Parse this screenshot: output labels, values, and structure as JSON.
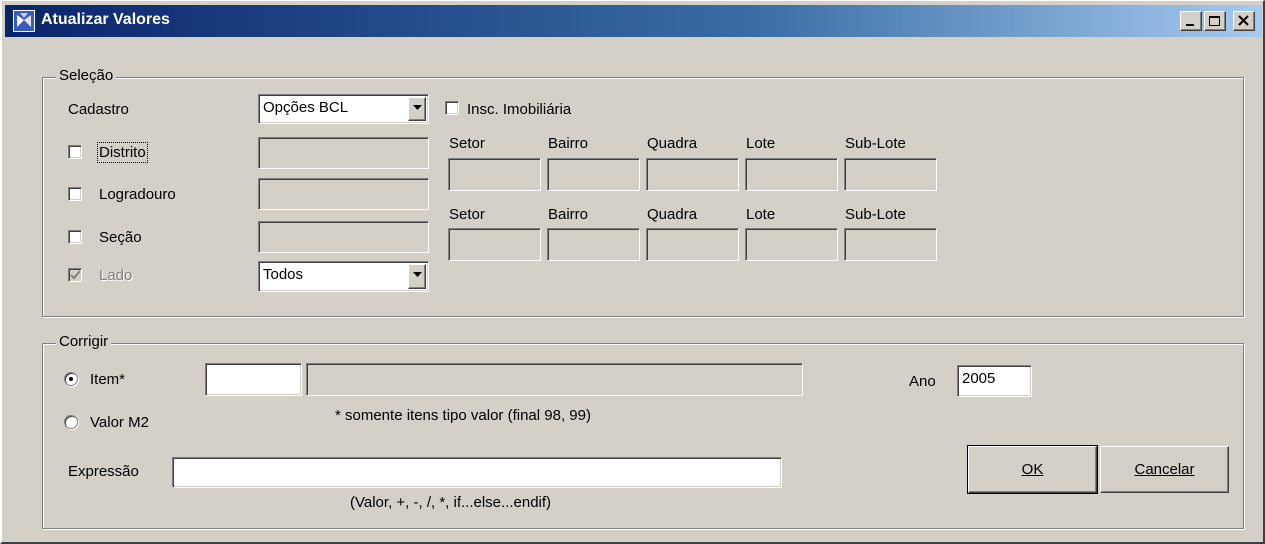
{
  "window": {
    "title": "Atualizar Valores",
    "icon": "app-icon",
    "controls": [
      "minimize-icon",
      "maximize-icon",
      "close-icon"
    ]
  },
  "selecao": {
    "group_title": "Seleção",
    "cadastro_label": "Cadastro",
    "cadastro_value": "Opções BCL",
    "insc_label": "Insc. Imobiliária",
    "insc_checked": false,
    "distrito_label": "Distrito",
    "distrito_checked": false,
    "logradouro_label": "Logradouro",
    "logradouro_checked": false,
    "secao_label": "Seção",
    "secao_checked": false,
    "lado_label": "Lado",
    "lado_checked": true,
    "lado_value": "Todos",
    "columns": [
      "Setor",
      "Bairro",
      "Quadra",
      "Lote",
      "Sub-Lote"
    ],
    "columns2": [
      "Setor",
      "Bairro",
      "Quadra",
      "Lote",
      "Sub-Lote"
    ]
  },
  "corrigir": {
    "group_title": "Corrigir",
    "item_label": "Item*",
    "item_selected": true,
    "valor_label": "Valor M2",
    "note": "* somente itens tipo valor (final 98, 99)",
    "ano_label": "Ano",
    "ano_value": "2005",
    "expressao_label": "Expressão",
    "expressao_value": "",
    "expressao_hint": "(Valor, +, -, /, *, if...else...endif)"
  },
  "buttons": {
    "ok_label": "OK",
    "cancel_label": "Cancelar"
  },
  "colors": {
    "title_start": "#0a246a",
    "title_end": "#a6caf0",
    "face": "#d4d0c8"
  }
}
